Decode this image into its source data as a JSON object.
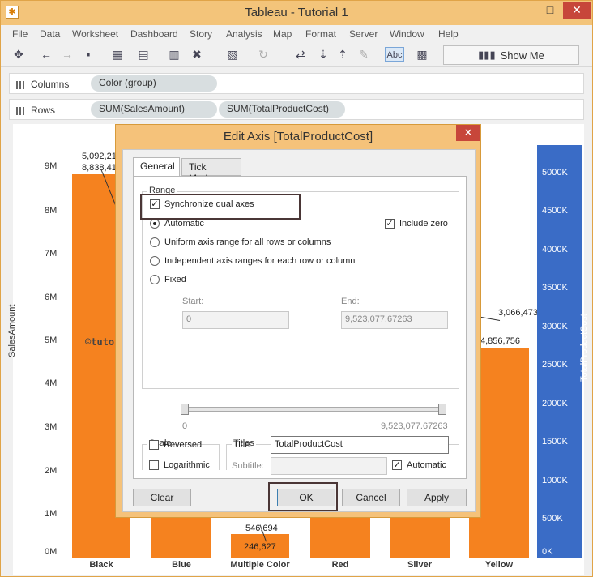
{
  "window": {
    "title": "Tableau - Tutorial 1"
  },
  "menu": [
    "File",
    "Data",
    "Worksheet",
    "Dashboard",
    "Story",
    "Analysis",
    "Map",
    "Format",
    "Server",
    "Window",
    "Help"
  ],
  "toolbar": {
    "show_me_label": "Show Me",
    "abc_label": "Abc"
  },
  "shelves": {
    "columns_label": "Columns",
    "rows_label": "Rows",
    "columns_pills": [
      "Color (group)"
    ],
    "rows_pills": [
      "SUM(SalesAmount)",
      "SUM(TotalProductCost)"
    ]
  },
  "chart_data": {
    "type": "bar",
    "categories": [
      "Black",
      "Blue",
      "Multiple Color",
      "Red",
      "Silver",
      "Yellow"
    ],
    "ylabel": "SalesAmount",
    "y2label": "TotalProductCost",
    "yticks": [
      "9M",
      "8M",
      "7M",
      "6M",
      "5M",
      "4M",
      "3M",
      "2M",
      "1M",
      "0M"
    ],
    "y2ticks": [
      "5000K",
      "4500K",
      "4000K",
      "3500K",
      "3000K",
      "2500K",
      "2000K",
      "1500K",
      "1000K",
      "500K",
      "0K"
    ],
    "visible_labels": {
      "black_cost": "5,092,21",
      "black_sales": "8,838,41",
      "multiple_cost": "246,627",
      "multiple_sales": "546,694",
      "yellow_cost": "3,066,473",
      "yellow_sales": "4,856,756"
    }
  },
  "watermark": "©tutorialgateway.org",
  "dialog": {
    "title": "Edit Axis [TotalProductCost]",
    "tabs": [
      "General",
      "Tick Marks"
    ],
    "range_label": "Range",
    "sync_label": "Synchronize dual axes",
    "sync_checked": true,
    "options": [
      "Automatic",
      "Uniform axis range for all rows or columns",
      "Independent axis ranges for each row or column",
      "Fixed"
    ],
    "include_zero_label": "Include zero",
    "include_zero_checked": true,
    "start_label": "Start:",
    "end_label": "End:",
    "start_value": "0",
    "end_value": "9,523,077.67263",
    "slider_min": "0",
    "slider_max": "9,523,077.67263",
    "scale_label": "Scale",
    "reversed_label": "Reversed",
    "logarithmic_label": "Logarithmic",
    "titles_label": "Titles",
    "title_field_label": "Title:",
    "title_field_value": "TotalProductCost",
    "subtitle_label": "Subtitle:",
    "automatic_label": "Automatic",
    "buttons": {
      "clear": "Clear",
      "ok": "OK",
      "cancel": "Cancel",
      "apply": "Apply"
    }
  },
  "colors": {
    "bar": "#f5821f",
    "axis2": "#3a6cc6",
    "titlebar": "#f3c47a"
  }
}
